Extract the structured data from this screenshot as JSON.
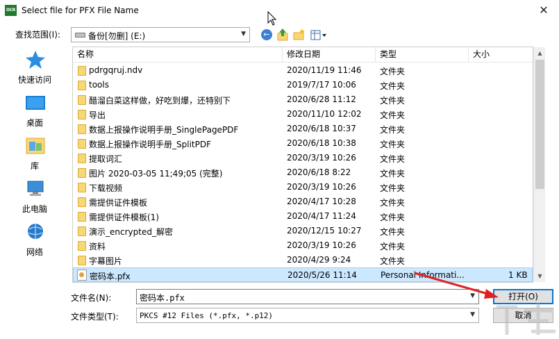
{
  "window": {
    "app_icon_text": "OCR",
    "title": "Select file for PFX File Name",
    "close_glyph": "✕"
  },
  "lookin": {
    "label": "查找范围(I):",
    "value": "备份[勿删] (E:)"
  },
  "toolbar": {
    "back_icon": "back-arrow-icon",
    "up_icon": "up-folder-icon",
    "new_folder_icon": "new-folder-icon",
    "view_icon": "view-menu-icon"
  },
  "places": [
    {
      "label": "快速访问",
      "icon": "star-icon"
    },
    {
      "label": "桌面",
      "icon": "desktop-icon"
    },
    {
      "label": "库",
      "icon": "library-icon"
    },
    {
      "label": "此电脑",
      "icon": "computer-icon"
    },
    {
      "label": "网络",
      "icon": "network-icon"
    }
  ],
  "columns": {
    "name": "名称",
    "date": "修改日期",
    "type": "类型",
    "size": "大小"
  },
  "files": [
    {
      "name": "pdrgqruj.ndv",
      "date": "2020/11/19 11:46",
      "type": "文件夹",
      "size": ""
    },
    {
      "name": "tools",
      "date": "2019/7/17 10:06",
      "type": "文件夹",
      "size": ""
    },
    {
      "name": "醋溜白菜这样做，好吃到爆，还特别下",
      "date": "2020/6/28 11:12",
      "type": "文件夹",
      "size": ""
    },
    {
      "name": "导出",
      "date": "2020/11/10 12:02",
      "type": "文件夹",
      "size": ""
    },
    {
      "name": "数据上报操作说明手册_SinglePagePDF",
      "date": "2020/6/18 10:37",
      "type": "文件夹",
      "size": ""
    },
    {
      "name": "数据上报操作说明手册_SplitPDF",
      "date": "2020/6/18 10:38",
      "type": "文件夹",
      "size": ""
    },
    {
      "name": "提取词汇",
      "date": "2020/3/19 10:26",
      "type": "文件夹",
      "size": ""
    },
    {
      "name": "图片 2020-03-05 11;49;05 (完整)",
      "date": "2020/6/18 8:22",
      "type": "文件夹",
      "size": ""
    },
    {
      "name": "下载视频",
      "date": "2020/3/19 10:26",
      "type": "文件夹",
      "size": ""
    },
    {
      "name": "需提供证件模板",
      "date": "2020/4/17 10:28",
      "type": "文件夹",
      "size": ""
    },
    {
      "name": "需提供证件模板(1)",
      "date": "2020/4/17 11:24",
      "type": "文件夹",
      "size": ""
    },
    {
      "name": "演示_encrypted_解密",
      "date": "2020/12/15 10:27",
      "type": "文件夹",
      "size": ""
    },
    {
      "name": "资料",
      "date": "2020/3/19 10:26",
      "type": "文件夹",
      "size": ""
    },
    {
      "name": "字幕图片",
      "date": "2020/4/29 9:24",
      "type": "文件夹",
      "size": ""
    },
    {
      "name": "密码本.pfx",
      "date": "2020/5/26 11:14",
      "type": "Personal Informati...",
      "size": "1 KB",
      "selected": true
    }
  ],
  "form": {
    "filename_label": "文件名(N):",
    "filename_value": "密码本.pfx",
    "filetype_label": "文件类型(T):",
    "filetype_value": "PKCS #12 Files (*.pfx, *.p12)",
    "open_label": "打开(O)",
    "cancel_label": "取消"
  },
  "colors": {
    "selection_bg": "#cce8ff",
    "accent": "#0078d7",
    "annotation_arrow": "#e02020"
  }
}
